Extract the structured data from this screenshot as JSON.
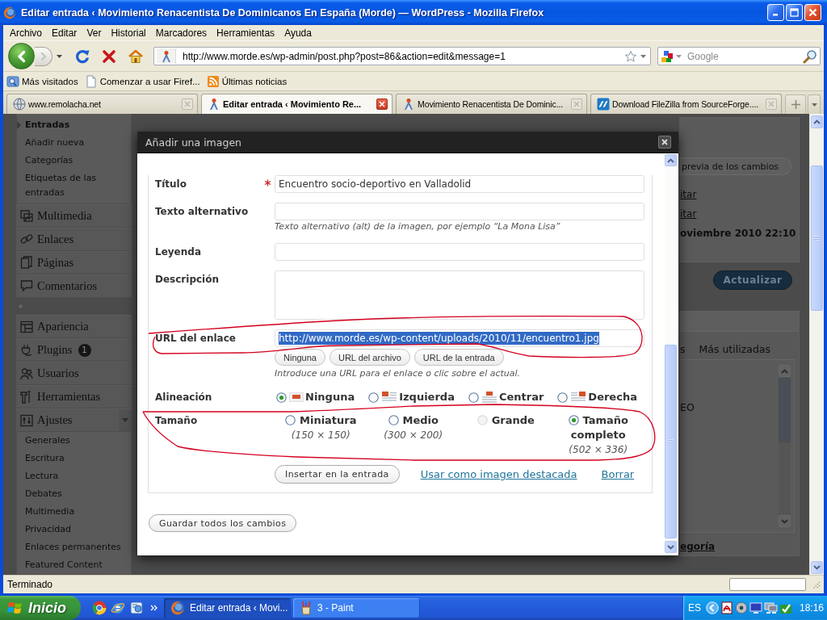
{
  "window": {
    "title": "Editar entrada ‹ Movimiento Renacentista De Dominicanos En España (Morde) — WordPress - Mozilla Firefox"
  },
  "menu_bar": [
    "Archivo",
    "Editar",
    "Ver",
    "Historial",
    "Marcadores",
    "Herramientas",
    "Ayuda"
  ],
  "nav_bar": {
    "url": "http://www.morde.es/wp-admin/post.php?post=86&action=edit&message=1",
    "search": {
      "placeholder": "Google"
    }
  },
  "bookmarks": [
    {
      "label": "Más visitados",
      "kind": "smart"
    },
    {
      "label": "Comenzar a usar Firef...",
      "kind": "page"
    },
    {
      "label": "Últimas noticias",
      "kind": "feed"
    }
  ],
  "tabs": [
    {
      "label": "www.remolacha.net",
      "kind": "globe",
      "selected": false
    },
    {
      "label": "Editar entrada ‹ Movimiento Re...",
      "kind": "site",
      "selected": true
    },
    {
      "label": "Movimiento Renacentista De Dominic...",
      "kind": "site",
      "selected": false
    },
    {
      "label": "Download FileZilla from SourceForge....",
      "kind": "tile",
      "selected": false
    }
  ],
  "sidebar": {
    "submenu": [
      {
        "label": "Entradas",
        "selected": true
      },
      {
        "label": "Añadir nueva",
        "selected": false
      },
      {
        "label": "Categorías",
        "selected": false
      },
      {
        "label": "Etiquetas de las entradas",
        "selected": false
      }
    ],
    "menu_groups": [
      [
        {
          "label": "Multimedia",
          "kind": "media"
        },
        {
          "label": "Enlaces",
          "kind": "links"
        },
        {
          "label": "Páginas",
          "kind": "pages"
        },
        {
          "label": "Comentarios",
          "kind": "comments"
        }
      ],
      [
        {
          "label": "Apariencia",
          "kind": "appearance"
        },
        {
          "label": "Plugins",
          "kind": "plugins",
          "badge": "1"
        },
        {
          "label": "Usuarios",
          "kind": "users"
        },
        {
          "label": "Herramientas",
          "kind": "tools"
        },
        {
          "label": "Ajustes",
          "kind": "settings",
          "children": [
            {
              "label": "Generales"
            },
            {
              "label": "Escritura"
            },
            {
              "label": "Lectura"
            },
            {
              "label": "Debates"
            },
            {
              "label": "Multimedia"
            },
            {
              "label": "Privacidad"
            },
            {
              "label": "Enlaces permanentes"
            },
            {
              "label": "Featured Content"
            }
          ]
        }
      ]
    ]
  },
  "background": {
    "preview_button": "previa de los cambios",
    "edit_links": [
      "itar",
      "itar"
    ],
    "date": "oviembre 2010 22:10",
    "update_button": "Actualizar",
    "category_tabs": [
      "s",
      "Más utilizadas"
    ],
    "category_item": "EO",
    "add_category_link": "egoría"
  },
  "dialog": {
    "title": "Añadir una imagen",
    "fields": [
      {
        "label": "Título",
        "kind": "text",
        "required": true,
        "value": "Encuentro socio-deportivo en Valladolid"
      },
      {
        "label": "Texto alternativo",
        "kind": "text",
        "required": false,
        "help": "Texto alternativo (alt) de la imagen, por ejemplo “La Mona Lisa”"
      },
      {
        "label": "Leyenda",
        "kind": "text",
        "required": false
      },
      {
        "label": "Descripción",
        "kind": "textarea",
        "required": false
      }
    ],
    "link_url": {
      "label": "URL del enlace",
      "value": "http://www.morde.es/wp-content/uploads/2010/11/encuentro1.jpg",
      "highlighted": true,
      "buttons": [
        "Ninguna",
        "URL del archivo",
        "URL de la entrada"
      ],
      "help": "Introduce una URL para el enlace o clic sobre el actual."
    },
    "alignment": {
      "label": "Alineación",
      "options": [
        {
          "label": "Ninguna",
          "kind": "none",
          "selected": true
        },
        {
          "label": "Izquierda",
          "kind": "left",
          "selected": false
        },
        {
          "label": "Centrar",
          "kind": "center",
          "selected": false
        },
        {
          "label": "Derecha",
          "kind": "right",
          "selected": false
        }
      ]
    },
    "size": {
      "label": "Tamaño",
      "options": [
        {
          "label": "Miniatura",
          "dims": "(150 × 150)",
          "selected": false,
          "disabled": false
        },
        {
          "label": "Medio",
          "dims": "(300 × 200)",
          "selected": false,
          "disabled": false
        },
        {
          "label": "Grande",
          "selected": false,
          "disabled": true
        },
        {
          "label": "Tamaño completo",
          "dims": "(502 × 336)",
          "selected": true,
          "disabled": false
        }
      ]
    },
    "actions": {
      "insert_button": "Insertar en la entrada",
      "featured_link": "Usar como imagen destacada",
      "delete_link": "Borrar"
    },
    "save_button": "Guardar todos los cambios"
  },
  "status_bar": {
    "text": "Terminado"
  },
  "taskbar": {
    "start": "Inicio",
    "tasks": [
      {
        "label": "Editar entrada ‹ Movi...",
        "kind": "browser",
        "selected": true
      },
      {
        "label": "3 - Paint",
        "kind": "paint",
        "selected": false
      }
    ],
    "language": "ES",
    "clock": "18:16"
  }
}
